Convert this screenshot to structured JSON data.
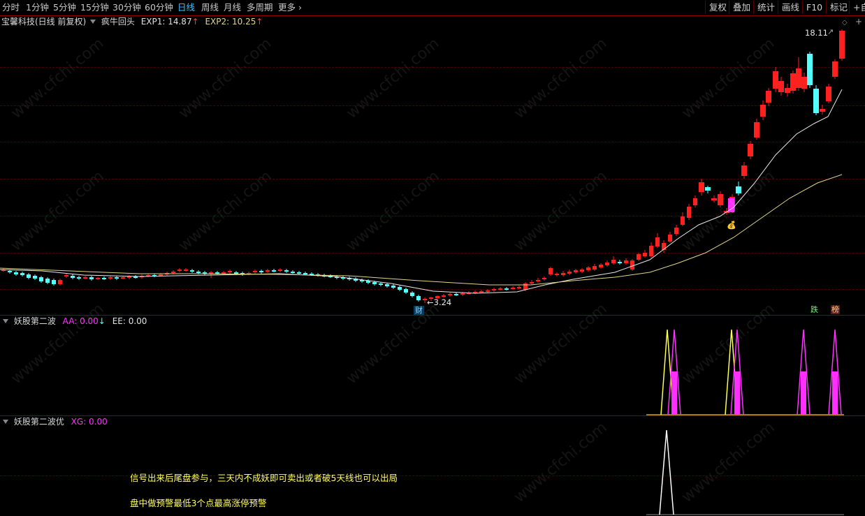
{
  "toolbar": {
    "periods": [
      "分时",
      "1分钟",
      "5分钟",
      "15分钟",
      "30分钟",
      "60分钟",
      "日线",
      "周线",
      "月线",
      "多周期",
      "更多"
    ],
    "active_period": "日线",
    "right_buttons": [
      "复权",
      "叠加",
      "统计",
      "画线",
      "F10",
      "标记",
      "+自"
    ]
  },
  "main_panel": {
    "stock_title": "宝馨科技(日线 前复权)",
    "indicator_name": "疯牛回头",
    "exp1_label": "EXP1: 14.87",
    "exp2_label": "EXP2: 10.25",
    "high_label": "18.11",
    "low_label": "3.24",
    "cai_tag": "财",
    "die_tag": "跌",
    "bang_tag": "榜"
  },
  "sub_panel_1": {
    "indicator_name": "妖股第二波",
    "aa_label": "AA: 0.00",
    "ee_label": "EE: 0.00"
  },
  "sub_panel_2": {
    "indicator_name": "妖股第二波优",
    "xg_label": "XG: 0.00",
    "note_line1": "信号出来后尾盘参与，三天内不成妖即可卖出或者破5天线也可以出局",
    "note_line2": "盘中做预警最低3个点最高涨停预警"
  },
  "watermark": "www.cfchi.com",
  "colors": {
    "up": "#ff2020",
    "down": "#54ffff",
    "ma_fast": "#e8e8e8",
    "ma_slow": "#e0d58a",
    "yellow_signal": "#ffff50",
    "magenta_signal": "#ff30ff",
    "white_signal": "#ffffff",
    "grid": "#8a0000"
  }
}
